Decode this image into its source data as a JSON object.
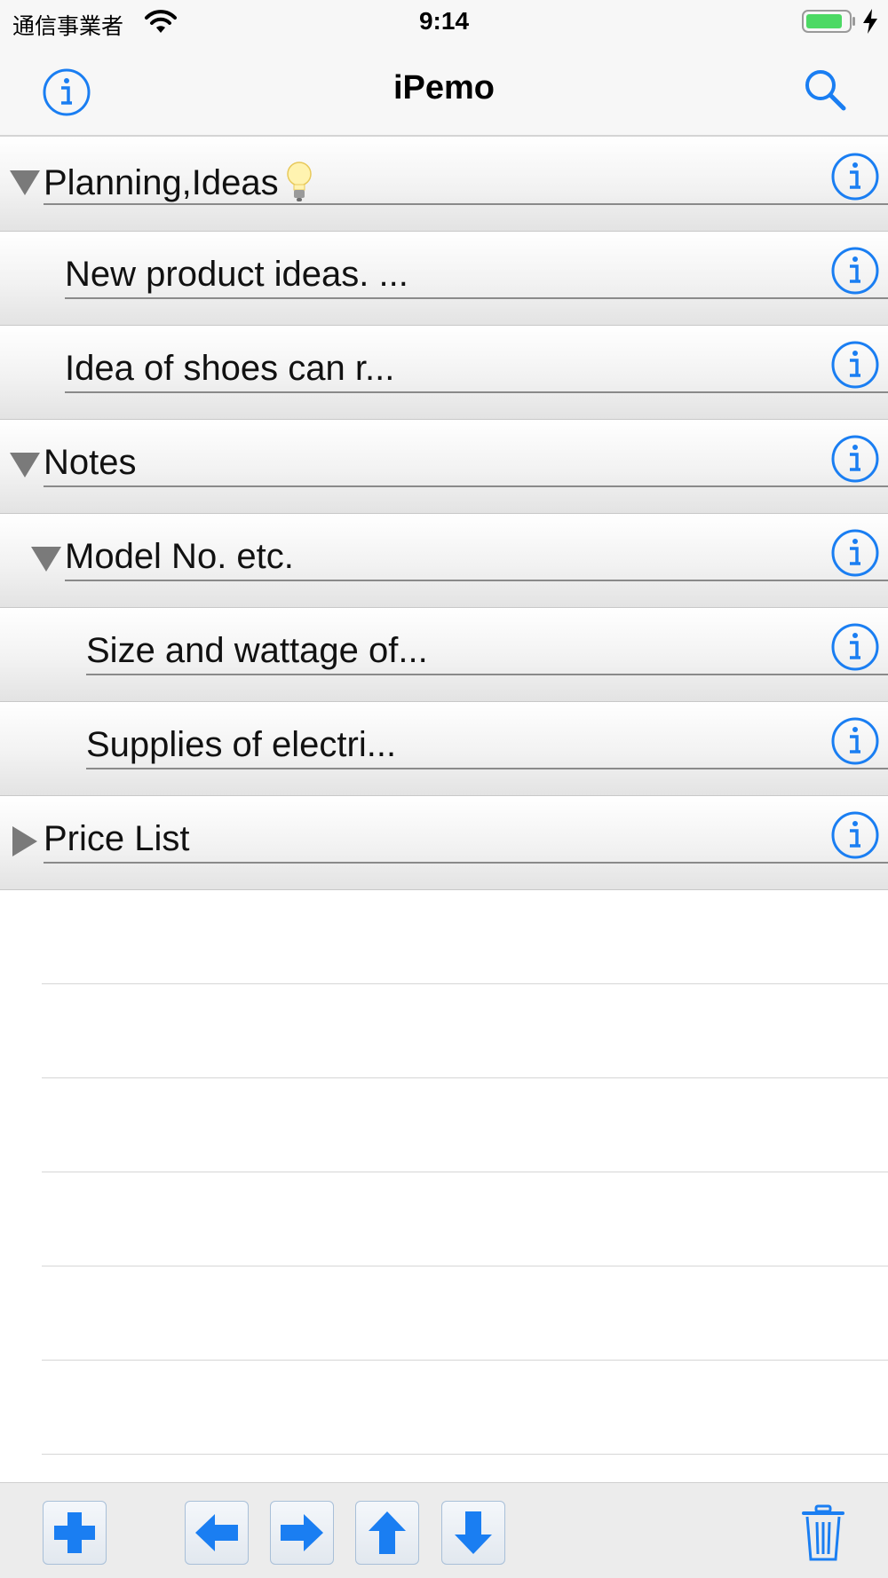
{
  "status_bar": {
    "carrier": "通信事業者",
    "time": "9:14"
  },
  "nav": {
    "title": "iPemo"
  },
  "rows": [
    {
      "text": "Planning,Ideas",
      "level": 0,
      "state": "expanded",
      "has_bulb": true
    },
    {
      "text": "New product ideas. ...",
      "level": 1,
      "state": "leaf"
    },
    {
      "text": "Idea of shoes can r...",
      "level": 1,
      "state": "leaf"
    },
    {
      "text": "Notes",
      "level": 0,
      "state": "expanded"
    },
    {
      "text": "Model No. etc.",
      "level": 1,
      "state": "expanded"
    },
    {
      "text": "Size and wattage of...",
      "level": 2,
      "state": "leaf"
    },
    {
      "text": "Supplies of electri...",
      "level": 2,
      "state": "leaf"
    },
    {
      "text": "Price List",
      "level": 0,
      "state": "collapsed"
    }
  ],
  "toolbar": {
    "buttons": [
      "add",
      "outdent",
      "indent",
      "move-up",
      "move-down",
      "delete"
    ]
  },
  "colors": {
    "accent": "#1a7ef2",
    "triangle": "#7a7a7a",
    "battery": "#4cd964"
  }
}
